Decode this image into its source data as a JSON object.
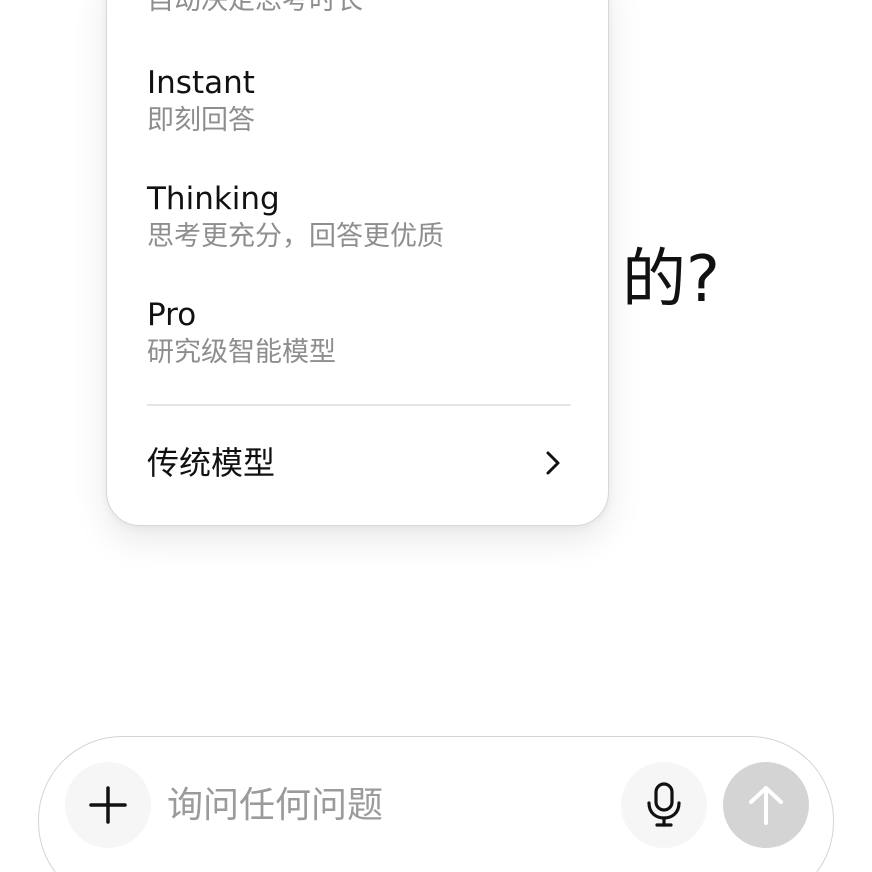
{
  "greeting": {
    "partial_text": "的?"
  },
  "model_menu": {
    "cut_off_item": {
      "desc": "自动决定思考时长"
    },
    "items": [
      {
        "title": "Instant",
        "desc": "即刻回答"
      },
      {
        "title": "Thinking",
        "desc": "思考更充分，回答更优质"
      },
      {
        "title": "Pro",
        "desc": "研究级智能模型"
      }
    ],
    "legacy": {
      "label": "传统模型",
      "icon": "chevron-right-icon"
    }
  },
  "composer": {
    "placeholder": "询问任何问题",
    "value": "",
    "plus_icon": "plus-icon",
    "mic_icon": "microphone-icon",
    "send_icon": "arrow-up-icon"
  },
  "colors": {
    "text_primary": "#111111",
    "text_secondary": "#8e8e8e",
    "send_disabled": "#d4d4d4",
    "button_bg": "#f6f6f6"
  }
}
